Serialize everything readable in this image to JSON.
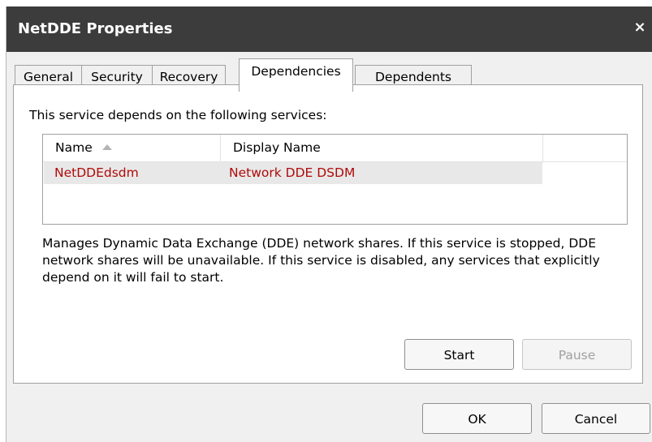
{
  "window": {
    "title": "NetDDE Properties",
    "close_glyph": "×"
  },
  "tabs": [
    {
      "label": "General",
      "active": false
    },
    {
      "label": "Security",
      "active": false
    },
    {
      "label": "Recovery",
      "active": false
    },
    {
      "label": "Dependencies",
      "active": true
    },
    {
      "label": "Dependents",
      "active": false
    }
  ],
  "dependencies": {
    "intro": "This service depends on the following services:",
    "columns": [
      {
        "label": "Name",
        "sort": "ascending"
      },
      {
        "label": "Display Name"
      }
    ],
    "rows": [
      {
        "name": "NetDDEdsdm",
        "display_name": "Network DDE DSDM"
      }
    ],
    "row_text_color": "#b00a0a",
    "description": "Manages Dynamic Data Exchange (DDE) network shares. If this service is stopped, DDE network shares will be unavailable. If this service is disabled, any services that explicitly depend on it will fail to start.",
    "start_label": "Start",
    "pause_label": "Pause",
    "pause_enabled": false
  },
  "footer": {
    "ok_label": "OK",
    "cancel_label": "Cancel"
  }
}
